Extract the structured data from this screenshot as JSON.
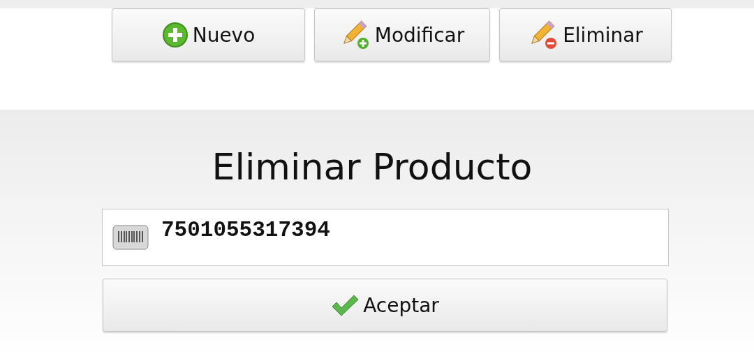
{
  "toolbar": {
    "buttons": [
      {
        "label": "Nuevo",
        "kind": "add"
      },
      {
        "label": "Modificar",
        "kind": "edit"
      },
      {
        "label": "Eliminar",
        "kind": "delete"
      }
    ]
  },
  "dialog": {
    "title": "Eliminar Producto",
    "code_field": {
      "value": "7501055317394"
    },
    "accept_button": {
      "label": "Aceptar"
    }
  }
}
